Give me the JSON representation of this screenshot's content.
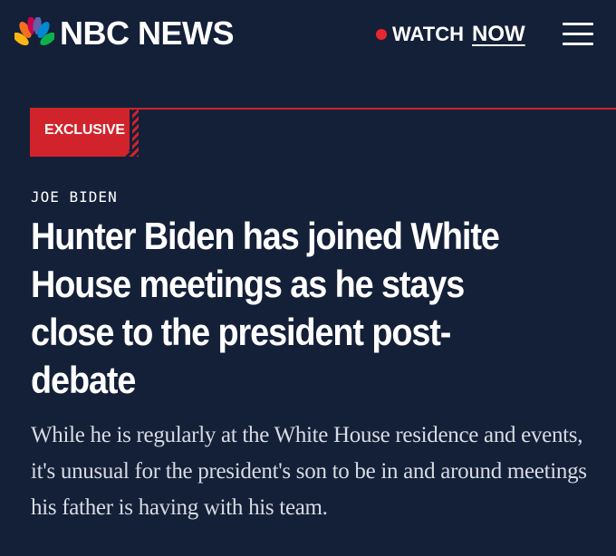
{
  "header": {
    "brand": "NBC NEWS",
    "logo_icon": "nbc-peacock-icon",
    "watch_label": "WATCH",
    "watch_now_label": "NOW",
    "live_dot_color": "#e8262f",
    "menu_icon": "hamburger-menu-icon"
  },
  "article": {
    "badge": "EXCLUSIVE",
    "kicker": "JOE BIDEN",
    "headline": "Hunter Biden has joined White House meetings as he stays close to the president post-debate",
    "dek": "While he is regularly at the White House residence and events, it's unusual for the president's son to be in and around meetings his father is having with his team."
  },
  "colors": {
    "background": "#142038",
    "accent_red": "#d1232b",
    "text": "#ffffff"
  }
}
